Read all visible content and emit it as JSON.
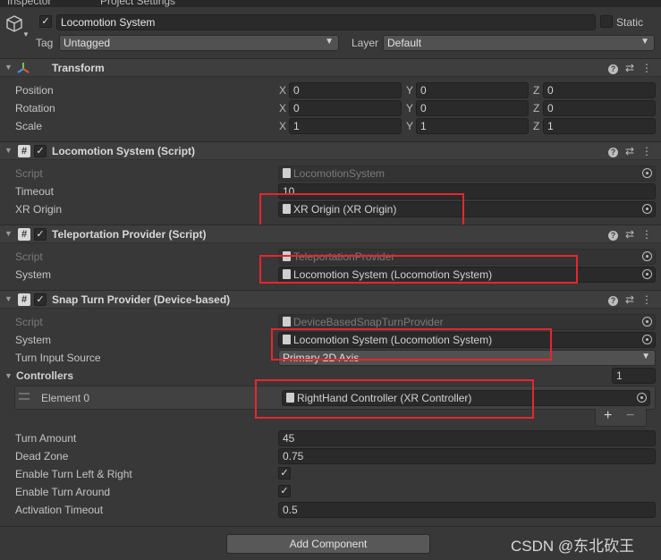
{
  "tabs": [
    "Inspector",
    "Project Settings"
  ],
  "object": {
    "name": "Locomotion System",
    "static_label": "Static",
    "tag_label": "Tag",
    "tag_value": "Untagged",
    "layer_label": "Layer",
    "layer_value": "Default"
  },
  "transform": {
    "title": "Transform",
    "rows": [
      {
        "label": "Position",
        "x": "0",
        "y": "0",
        "z": "0"
      },
      {
        "label": "Rotation",
        "x": "0",
        "y": "0",
        "z": "0"
      },
      {
        "label": "Scale",
        "x": "1",
        "y": "1",
        "z": "1"
      }
    ],
    "axis_x": "X",
    "axis_y": "Y",
    "axis_z": "Z"
  },
  "locomotion": {
    "title": "Locomotion System (Script)",
    "script_label": "Script",
    "script_value": "LocomotionSystem",
    "timeout_label": "Timeout",
    "timeout_value": "10",
    "origin_label": "XR Origin",
    "origin_value": "XR Origin (XR Origin)"
  },
  "teleport": {
    "title": "Teleportation Provider (Script)",
    "script_label": "Script",
    "script_value": "TeleportationProvider",
    "system_label": "System",
    "system_value": "Locomotion System (Locomotion System)"
  },
  "snap": {
    "title": "Snap Turn Provider (Device-based)",
    "script_label": "Script",
    "script_value": "DeviceBasedSnapTurnProvider",
    "system_label": "System",
    "system_value": "Locomotion System (Locomotion System)",
    "input_label": "Turn Input Source",
    "input_value": "Primary 2D Axis",
    "controllers_label": "Controllers",
    "controllers_count": "1",
    "element_label": "Element 0",
    "element_value": "RightHand Controller (XR Controller)",
    "plus": "+",
    "minus": "−",
    "turn_amount_label": "Turn Amount",
    "turn_amount_value": "45",
    "dead_zone_label": "Dead Zone",
    "dead_zone_value": "0.75",
    "left_right_label": "Enable Turn Left & Right",
    "around_label": "Enable Turn Around",
    "activation_label": "Activation Timeout",
    "activation_value": "0.5"
  },
  "add_component": "Add Component",
  "watermark": "CSDN @东北砍王",
  "icons": {
    "help": "?",
    "settings": "⇄",
    "more": "⋮",
    "check": "✓",
    "fold": "▼",
    "script": "#"
  },
  "colors": {
    "highlight": "#e6262f"
  }
}
